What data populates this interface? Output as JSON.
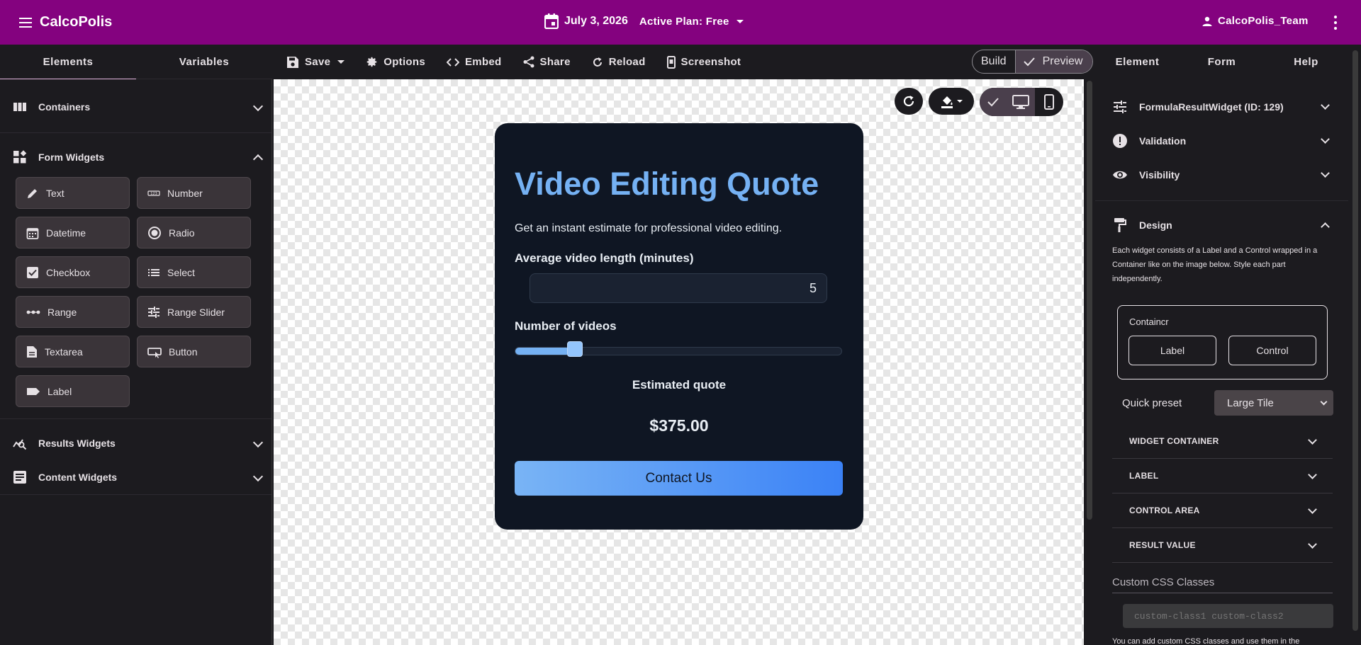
{
  "app": {
    "name": "CalcoPolis",
    "date": "July 3, 2026",
    "plan": "Active Plan: Free",
    "user": "CalcoPolis_Team"
  },
  "left_tabs": [
    "Elements",
    "Variables"
  ],
  "toolbar": {
    "save": "Save",
    "options": "Options",
    "embed": "Embed",
    "share": "Share",
    "reload": "Reload",
    "screenshot": "Screenshot"
  },
  "mode": {
    "build": "Build",
    "preview": "Preview"
  },
  "right_tabs": [
    "Element",
    "Form",
    "Help"
  ],
  "left_panel": {
    "containers": "Containers",
    "form_widgets": "Form Widgets",
    "widgets": [
      "Text",
      "Number",
      "Datetime",
      "Radio",
      "Checkbox",
      "Select",
      "Range",
      "Range Slider",
      "Textarea",
      "Button",
      "Label"
    ],
    "results_widgets": "Results Widgets",
    "content_widgets": "Content Widgets"
  },
  "card": {
    "title": "Video Editing Quote",
    "subtitle": "Get an instant estimate for professional video editing.",
    "length_label": "Average video length (minutes)",
    "length_value": "5",
    "videos_label": "Number of videos",
    "slider_fraction": 0.166,
    "estimate_label": "Estimated quote",
    "estimate_value": "$375.00",
    "contact_button": "Contact Us"
  },
  "right_panel": {
    "widget_header": "FormulaResultWidget (ID: 129)",
    "validation": "Validation",
    "visibility": "Visibility",
    "design": "Design",
    "design_desc": "Each widget consists of a Label and a Control wrapped in a Container like on the image below. Style each part independently.",
    "diagram_container": "Containcr",
    "diagram_label": "Label",
    "diagram_control": "Control",
    "preset_label": "Quick preset",
    "preset_value": "Large Tile",
    "sections": [
      "WIDGET CONTAINER",
      "LABEL",
      "CONTROL AREA",
      "RESULT VALUE"
    ],
    "custom_css_label": "Custom CSS Classes",
    "custom_css_placeholder": "custom-class1 custom-class2",
    "custom_css_note": "You can add custom CSS classes and use them in the"
  },
  "colors": {
    "brand": "#84027f",
    "card_bg": "#0f1623",
    "card_title": "#75b1f3",
    "button_start": "#79b4f5",
    "button_end": "#3b82f6"
  }
}
